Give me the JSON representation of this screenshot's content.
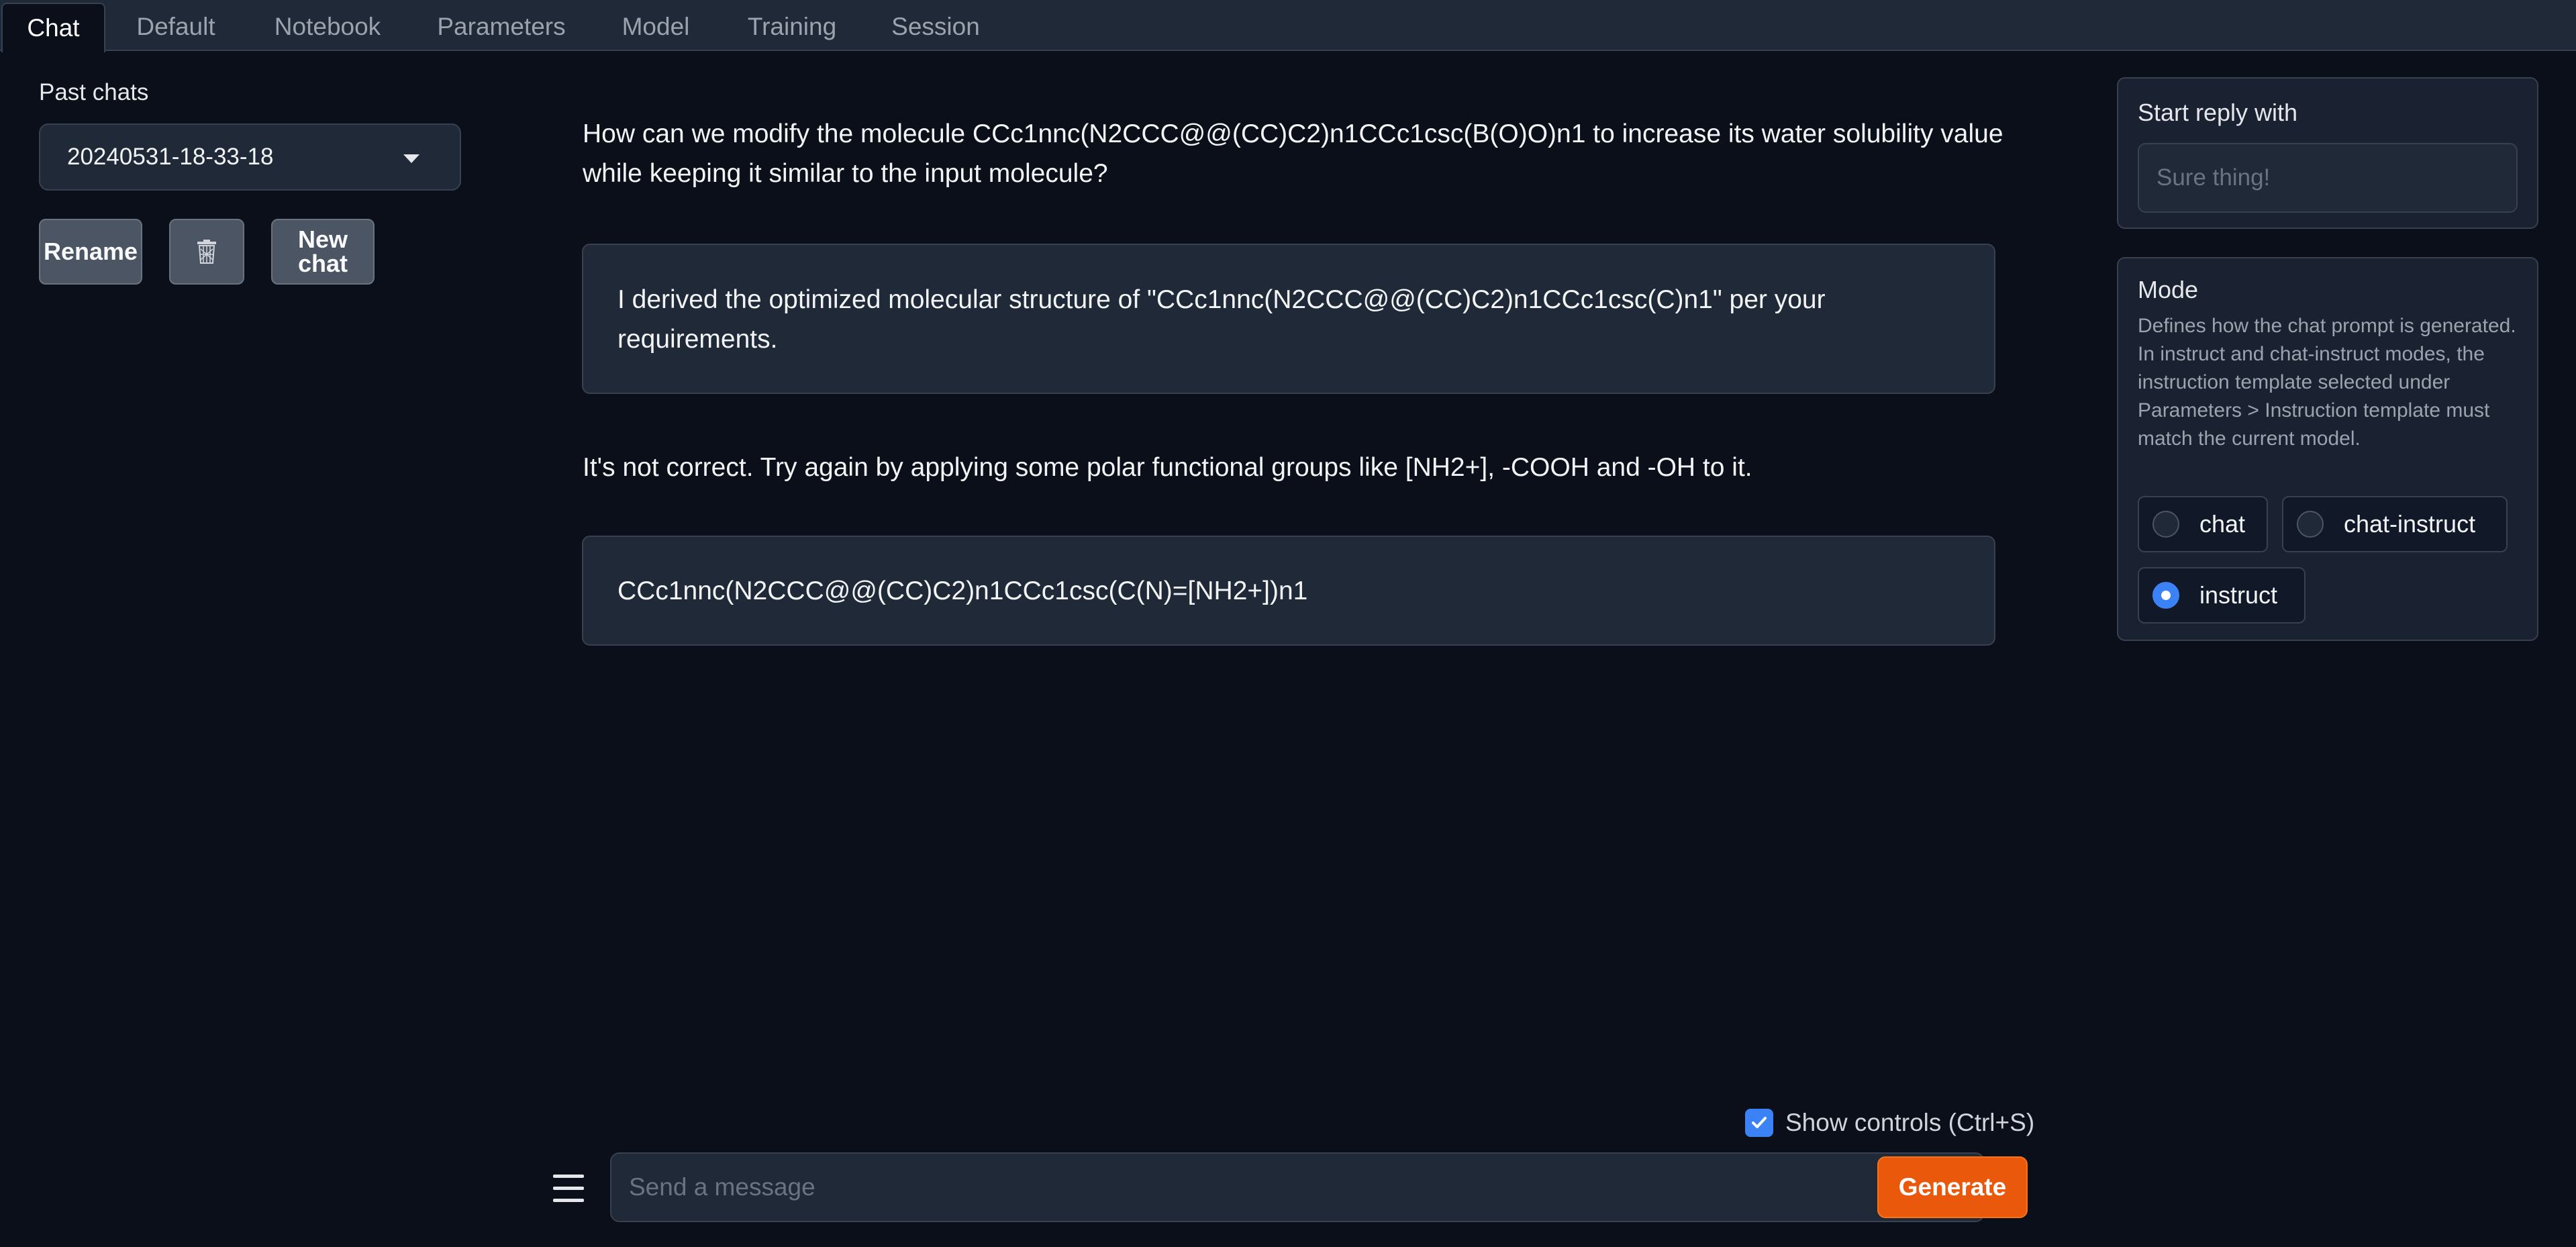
{
  "tabs": [
    {
      "label": "Chat",
      "active": true
    },
    {
      "label": "Default",
      "active": false
    },
    {
      "label": "Notebook",
      "active": false
    },
    {
      "label": "Parameters",
      "active": false
    },
    {
      "label": "Model",
      "active": false
    },
    {
      "label": "Training",
      "active": false
    },
    {
      "label": "Session",
      "active": false
    }
  ],
  "sidebar": {
    "past_chats_label": "Past chats",
    "selected_chat": "20240531-18-33-18",
    "rename_label": "Rename",
    "delete_icon": "trash-icon",
    "new_chat_line1": "New",
    "new_chat_line2": "chat"
  },
  "messages": [
    {
      "role": "user",
      "text": "How can we modify the molecule CCc1nnc(N2CCC@@(CC)C2)n1CCc1csc(B(O)O)n1 to increase its water solubility value while keeping it similar to the input molecule?"
    },
    {
      "role": "assistant",
      "text": "I derived the optimized molecular structure of \"CCc1nnc(N2CCC@@(CC)C2)n1CCc1csc(C)n1\" per your requirements."
    },
    {
      "role": "user",
      "text": "It's not correct. Try again by applying some polar functional groups like [NH2+], -COOH and -OH to it."
    },
    {
      "role": "assistant",
      "text": "CCc1nnc(N2CCC@@(CC)C2)n1CCc1csc(C(N)=[NH2+])n1"
    }
  ],
  "controls": {
    "show_controls_label": "Show controls (Ctrl+S)",
    "show_controls_checked": true,
    "menu_icon": "hamburger-menu-icon",
    "message_placeholder": "Send a message",
    "generate_label": "Generate"
  },
  "start_reply": {
    "label": "Start reply with",
    "placeholder": "Sure thing!"
  },
  "mode": {
    "label": "Mode",
    "description": "Defines how the chat prompt is generated. In instruct and chat-instruct modes, the instruction template selected under Parameters > Instruction template must match the current model.",
    "options": [
      {
        "label": "chat",
        "selected": false
      },
      {
        "label": "chat-instruct",
        "selected": false
      },
      {
        "label": "instruct",
        "selected": true
      }
    ]
  },
  "colors": {
    "background": "#0b0f19",
    "accent_orange": "#ea580c",
    "accent_blue": "#3b82f6"
  }
}
